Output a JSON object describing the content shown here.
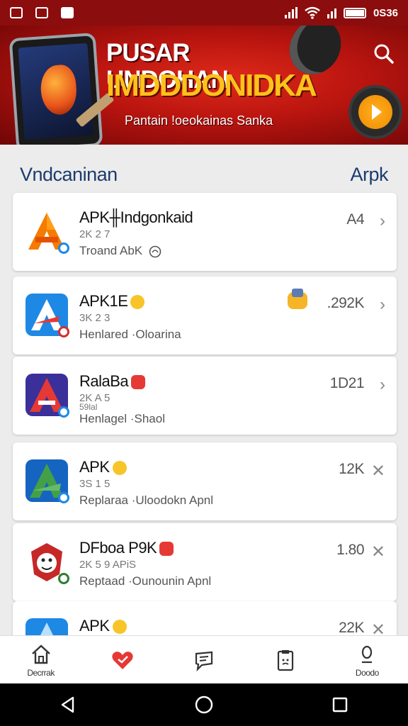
{
  "status_bar": {
    "time": "0S36"
  },
  "banner": {
    "title": "PUSAR UNDOHAN",
    "subtitle": "IMDDDONIDKA",
    "tagline": "Pantain !oeokainas Sanka"
  },
  "section": {
    "title": "Vndcaninan",
    "link": "Arpk"
  },
  "apps": [
    {
      "name": "APK╫Indgonkaid",
      "meta": "2K 2 7",
      "desc": "Troand AbK",
      "value": "A4",
      "icon": "orange-a-icon"
    },
    {
      "name": "APK1E",
      "meta": "3K 2 3",
      "desc": "Henlared ·Oloarina",
      "value": ".292K",
      "icon": "blue-a-icon"
    },
    {
      "name": "RalaBa",
      "meta": "2K A 5",
      "meta2": "59lal",
      "desc": "Henlagel ·Shaol",
      "value": "1D21",
      "icon": "purple-a-icon"
    },
    {
      "name": "APK",
      "meta": "3S 1 5",
      "desc": "Replaraa ·Uloodokn Apnl",
      "value": "12K",
      "icon": "green-a-icon"
    },
    {
      "name": "DFboa   P9K",
      "meta": "2K 5 9 APiS",
      "desc": "Reptaad ·Ounounin Apnl",
      "value": "1.80",
      "icon": "mascot-icon"
    },
    {
      "name": "APK",
      "meta": "",
      "desc": "",
      "value": "22K",
      "icon": "blue-a-icon"
    }
  ],
  "bottom_nav": [
    {
      "label": "Decrrak",
      "icon": "home-icon"
    },
    {
      "label": "",
      "icon": "heart-icon"
    },
    {
      "label": "",
      "icon": "chat-icon"
    },
    {
      "label": "",
      "icon": "clipboard-icon"
    },
    {
      "label": "Doodo",
      "icon": "profile-icon"
    }
  ],
  "colors": {
    "banner_red": "#b8140f",
    "accent_yellow": "#ffc21a",
    "title_blue": "#1b3c6e"
  }
}
